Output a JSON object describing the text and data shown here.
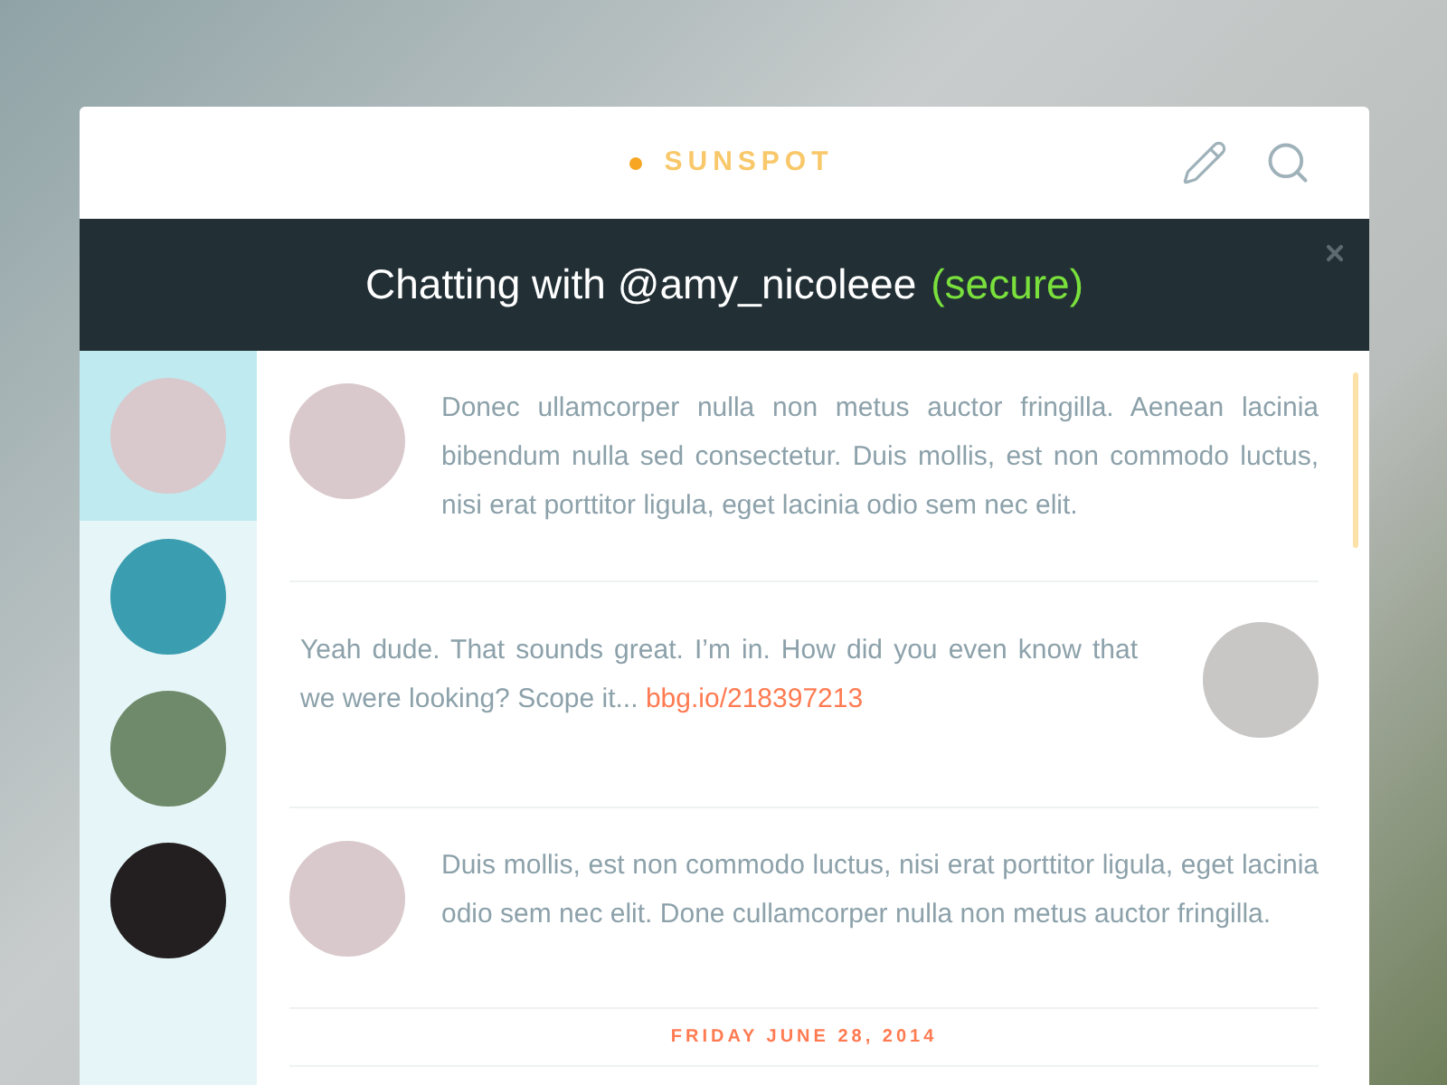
{
  "brand": "SUNSPOT",
  "chat_header": {
    "title": "Chatting with @amy_nicoleee",
    "status": "(secure)"
  },
  "contacts": [
    {
      "selected": true
    },
    {
      "selected": false
    },
    {
      "selected": false
    },
    {
      "selected": false
    }
  ],
  "messages": [
    {
      "kind": "incoming",
      "text": "Donec ullamcorper nulla non metus auctor fringilla. Aenean lacinia bibendum nulla sed consectetur. Duis mollis, est non commodo luctus, nisi erat porttitor ligula, eget lacinia odio sem nec elit."
    },
    {
      "kind": "outgoing",
      "text": "Yeah dude. That sounds great. I’m in. How did you even know that we were looking? Scope it...",
      "link": "bbg.io/218397213"
    },
    {
      "kind": "incoming",
      "text": "Duis mollis, est non commodo luctus, nisi erat porttitor ligula, eget lacinia odio sem nec elit. Done cullamcorper nulla non metus auctor fringilla."
    }
  ],
  "date_divider": "FRIDAY JUNE 28, 2014"
}
